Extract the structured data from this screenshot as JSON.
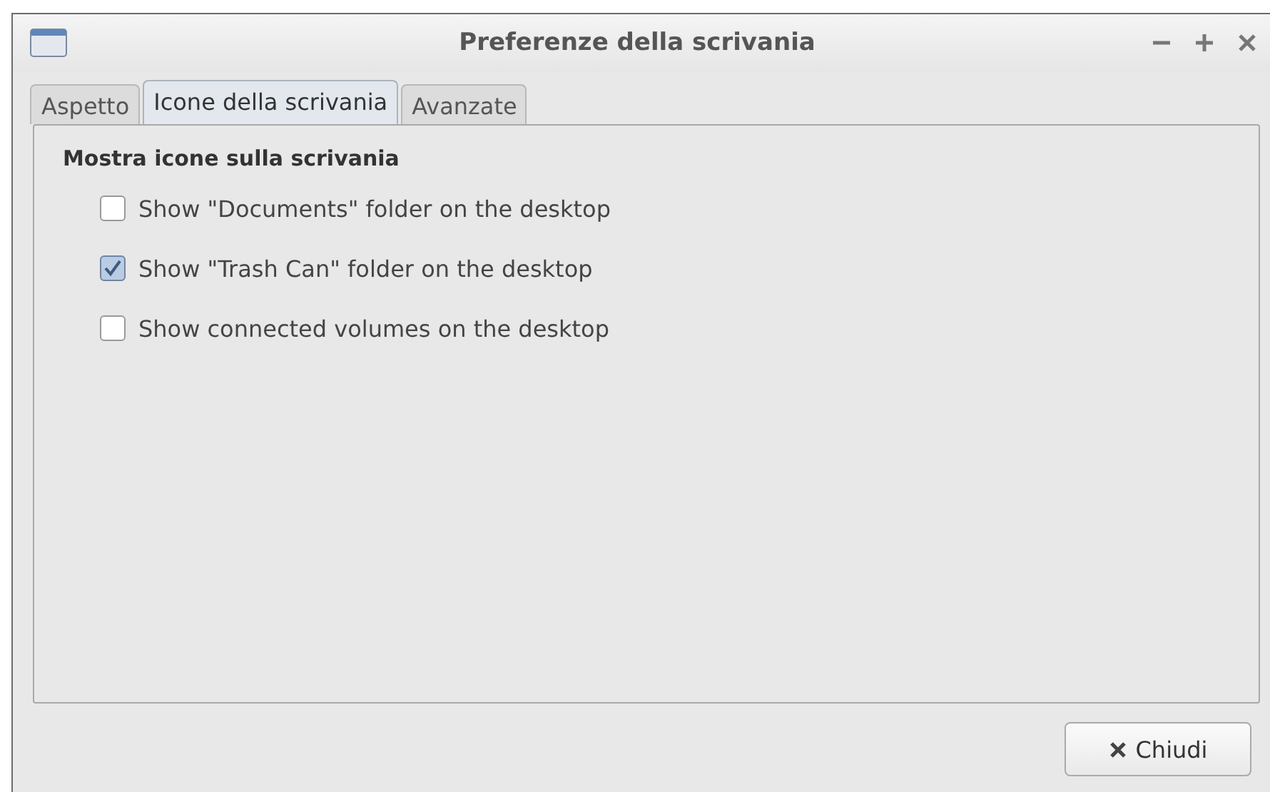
{
  "window": {
    "title": "Preferenze della scrivania"
  },
  "tabs": [
    {
      "label": "Aspetto",
      "selected": false
    },
    {
      "label": "Icone della scrivania",
      "selected": true
    },
    {
      "label": "Avanzate",
      "selected": false
    }
  ],
  "section": {
    "heading": "Mostra icone sulla scrivania",
    "options": [
      {
        "label": "Show \"Documents\" folder on the desktop",
        "checked": false
      },
      {
        "label": "Show \"Trash Can\" folder on the desktop",
        "checked": true
      },
      {
        "label": "Show connected volumes on the desktop",
        "checked": false
      }
    ]
  },
  "buttons": [
    {
      "label": "Chiudi"
    }
  ]
}
